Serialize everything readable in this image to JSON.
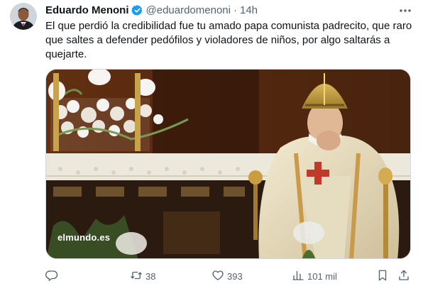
{
  "tweet": {
    "author_name": "Eduardo Menoni",
    "handle": "@eduardomenoni",
    "separator": "·",
    "time": "14h",
    "text": "El que perdió la credibilidad fue tu amado papa comunista padrecito, que raro que saltes a defender pedófilos y violadores de niños, por algo saltarás a quejarte.",
    "media": {
      "watermark": "elmundo.es"
    },
    "stats": {
      "retweets": "38",
      "likes": "393",
      "views": "101 mil"
    },
    "icons": {
      "verified": "verified-badge-icon",
      "more": "more-options-icon",
      "reply": "reply-icon",
      "retweet": "retweet-icon",
      "like": "heart-icon",
      "views": "views-chart-icon",
      "bookmark": "bookmark-icon",
      "share": "share-icon"
    },
    "colors": {
      "verified": "#1d9bf0",
      "text": "#0f1419",
      "secondary": "#536471"
    }
  }
}
